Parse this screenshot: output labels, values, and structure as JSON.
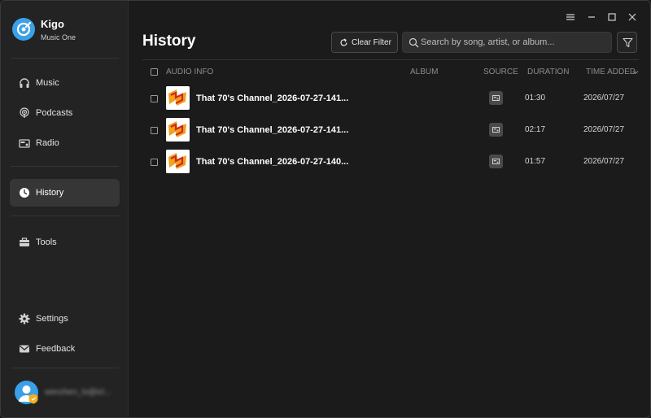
{
  "app": {
    "name": "Kigo",
    "subtitle": "Music One",
    "accent_color": "#3aa0e8"
  },
  "sidebar": {
    "items": [
      {
        "label": "Music",
        "icon": "headphones-icon"
      },
      {
        "label": "Podcasts",
        "icon": "podcast-icon"
      },
      {
        "label": "Radio",
        "icon": "radio-icon"
      },
      {
        "label": "History",
        "icon": "clock-icon",
        "active": true
      },
      {
        "label": "Tools",
        "icon": "toolbox-icon"
      },
      {
        "label": "Settings",
        "icon": "gear-icon"
      },
      {
        "label": "Feedback",
        "icon": "mail-icon"
      }
    ],
    "user": {
      "email": "wenzhen_lo@icl..."
    }
  },
  "window_controls": [
    "menu-icon",
    "minimize-icon",
    "maximize-icon",
    "close-icon"
  ],
  "main": {
    "title": "History",
    "clear_filter_label": "Clear Filter",
    "search_placeholder": "Search by song, artist, or album...",
    "columns": {
      "audio_info": "AUDIO INFO",
      "album": "ALBUM",
      "source": "SOURCE",
      "duration": "DURATION",
      "time_added": "TIME ADDED"
    },
    "rows": [
      {
        "title": "That 70's Channel_2026-07-27-141...",
        "album": "",
        "duration": "01:30",
        "time_added": "2026/07/27"
      },
      {
        "title": "That 70's Channel_2026-07-27-141...",
        "album": "",
        "duration": "02:17",
        "time_added": "2026/07/27"
      },
      {
        "title": "That 70's Channel_2026-07-27-140...",
        "album": "",
        "duration": "01:57",
        "time_added": "2026/07/27"
      }
    ]
  }
}
